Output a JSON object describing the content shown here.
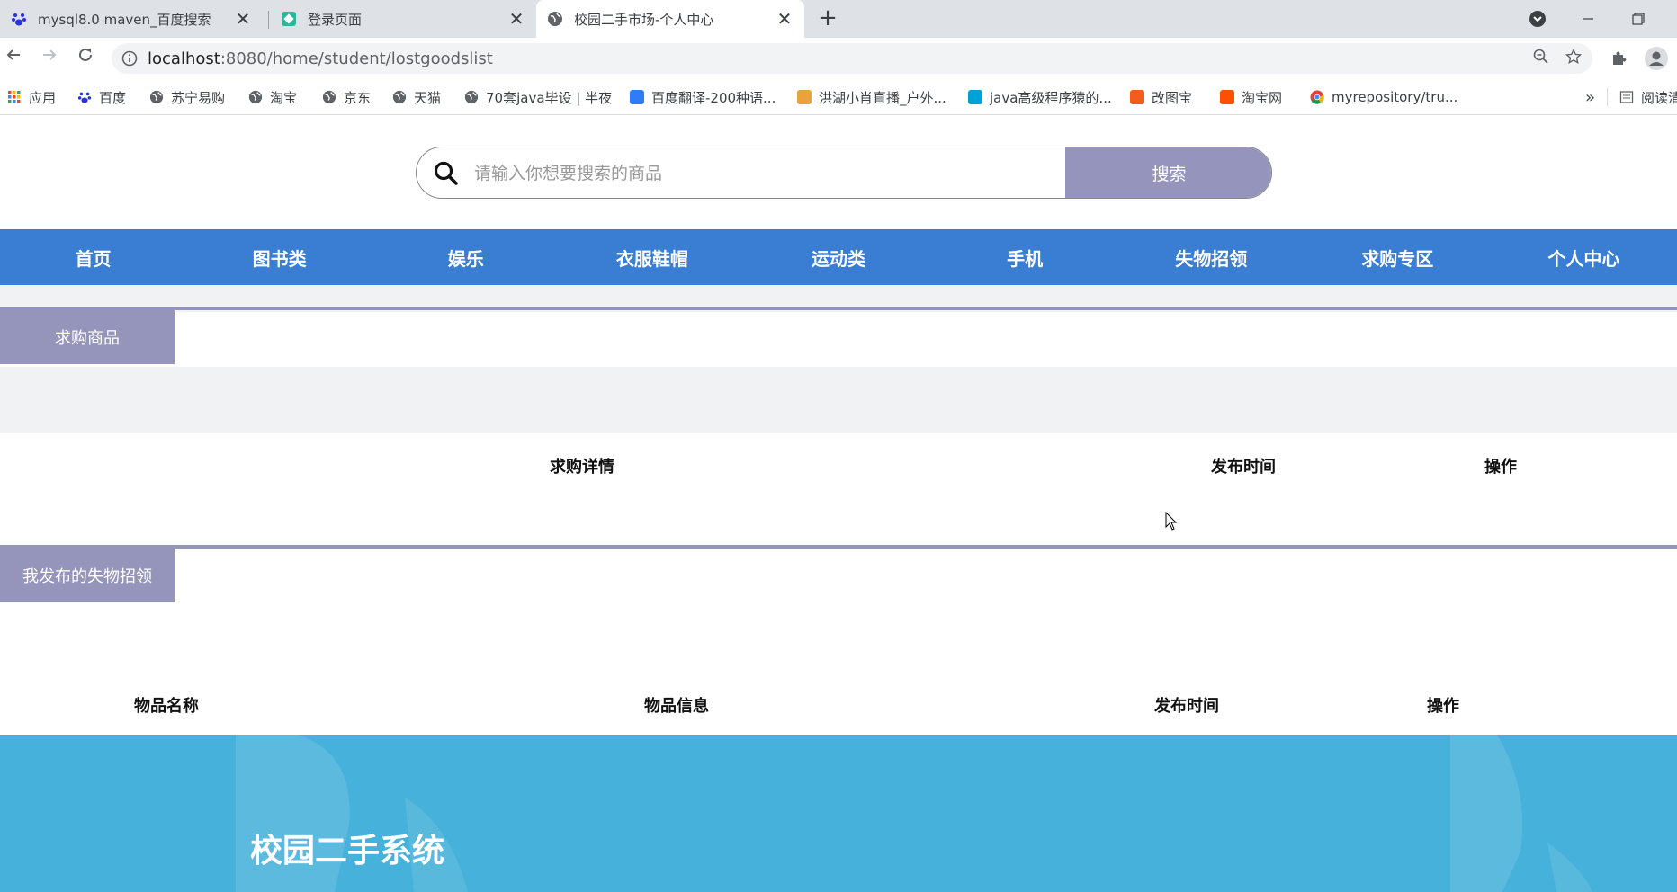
{
  "browser": {
    "tabs": [
      {
        "title": "mysql8.0 maven_百度搜索",
        "icon": "baidu-paw-icon",
        "active": false
      },
      {
        "title": "登录页面",
        "icon": "page-favicon-icon",
        "active": false
      },
      {
        "title": "校园二手市场-个人中心",
        "icon": "globe-icon",
        "active": true
      }
    ],
    "close_glyph": "✕",
    "new_tab_glyph": "+",
    "url_host": "localhost",
    "url_rest": ":8080/home/student/lostgoodslist",
    "bookmarks": [
      {
        "label": "应用",
        "icon": "apps-grid-icon"
      },
      {
        "label": "百度",
        "icon": "baidu-paw-icon"
      },
      {
        "label": "苏宁易购",
        "icon": "globe-icon"
      },
      {
        "label": "淘宝",
        "icon": "globe-icon"
      },
      {
        "label": "京东",
        "icon": "globe-icon"
      },
      {
        "label": "天猫",
        "icon": "globe-icon"
      },
      {
        "label": "70套java毕设 | 半夜",
        "icon": "globe-icon"
      },
      {
        "label": "百度翻译-200种语...",
        "icon": "translate-icon"
      },
      {
        "label": "洪湖小肖直播_户外...",
        "icon": "rocket-icon"
      },
      {
        "label": "java高级程序猿的...",
        "icon": "bilibili-icon"
      },
      {
        "label": "改图宝",
        "icon": "image-editor-icon"
      },
      {
        "label": "淘宝网",
        "icon": "taobao-icon"
      },
      {
        "label": "myrepository/tru...",
        "icon": "chrome-icon"
      }
    ],
    "bookmarks_overflow": "»",
    "reading_list": "阅读清"
  },
  "search": {
    "placeholder": "请输入你想要搜索的商品",
    "button_label": "搜索"
  },
  "nav": {
    "items": [
      "首页",
      "图书类",
      "娱乐",
      "衣服鞋帽",
      "运动类",
      "手机",
      "失物招领",
      "求购专区",
      "个人中心"
    ]
  },
  "wanted_section": {
    "tag": "求购商品",
    "headers": [
      "求购详情",
      "发布时间",
      "操作"
    ]
  },
  "lost_section": {
    "tag": "我发布的失物招领",
    "headers": [
      "物品名称",
      "物品信息",
      "发布时间",
      "操作"
    ]
  },
  "footer": {
    "title": "校园二手系统"
  },
  "colors": {
    "nav_blue": "#3a7ed4",
    "accent_purple": "#9594bb",
    "footer_blue": "#46b1da"
  }
}
